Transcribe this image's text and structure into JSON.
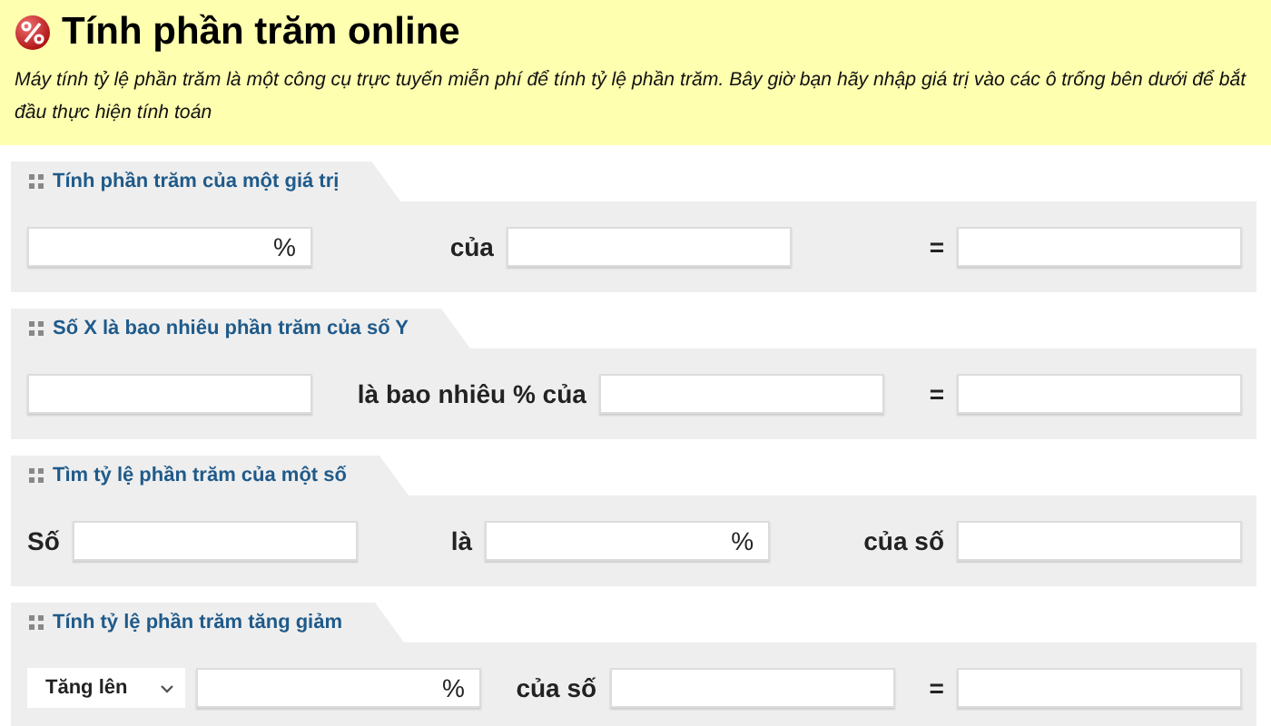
{
  "header": {
    "title": "Tính phần trăm online",
    "description": "Máy tính tỷ lệ phần trăm là một công cụ trực tuyến miễn phí để tính tỷ lệ phần trăm. Bây giờ bạn hãy nhập giá trị vào các ô trống bên dưới để bắt đầu thực hiện tính toán"
  },
  "sections": [
    {
      "title": "Tính phần trăm của một giá trị",
      "groups": [
        [
          {
            "kind": "field",
            "suffix": "%"
          }
        ],
        [
          {
            "kind": "label",
            "text": "của"
          },
          {
            "kind": "field"
          }
        ],
        [
          {
            "kind": "label",
            "text": "="
          },
          {
            "kind": "field"
          }
        ]
      ]
    },
    {
      "title": "Số X là bao nhiêu phần trăm của số Y",
      "groups": [
        [
          {
            "kind": "field"
          }
        ],
        [
          {
            "kind": "label",
            "text": "là bao nhiêu % của"
          },
          {
            "kind": "field"
          }
        ],
        [
          {
            "kind": "label",
            "text": "="
          },
          {
            "kind": "field"
          }
        ]
      ]
    },
    {
      "title": "Tìm tỷ lệ phần trăm của một số",
      "groups": [
        [
          {
            "kind": "label",
            "text": "Số"
          },
          {
            "kind": "field"
          }
        ],
        [
          {
            "kind": "label",
            "text": "là"
          },
          {
            "kind": "field",
            "suffix": "%"
          }
        ],
        [
          {
            "kind": "label",
            "text": "của số"
          },
          {
            "kind": "field"
          }
        ]
      ]
    },
    {
      "title": "Tính tỷ lệ phần trăm tăng giảm",
      "groups": [
        [
          {
            "kind": "select",
            "value": "Tăng lên"
          },
          {
            "kind": "field",
            "suffix": "%"
          }
        ],
        [
          {
            "kind": "label",
            "text": "của số"
          },
          {
            "kind": "field"
          }
        ],
        [
          {
            "kind": "label",
            "text": "="
          },
          {
            "kind": "field"
          }
        ]
      ]
    }
  ]
}
